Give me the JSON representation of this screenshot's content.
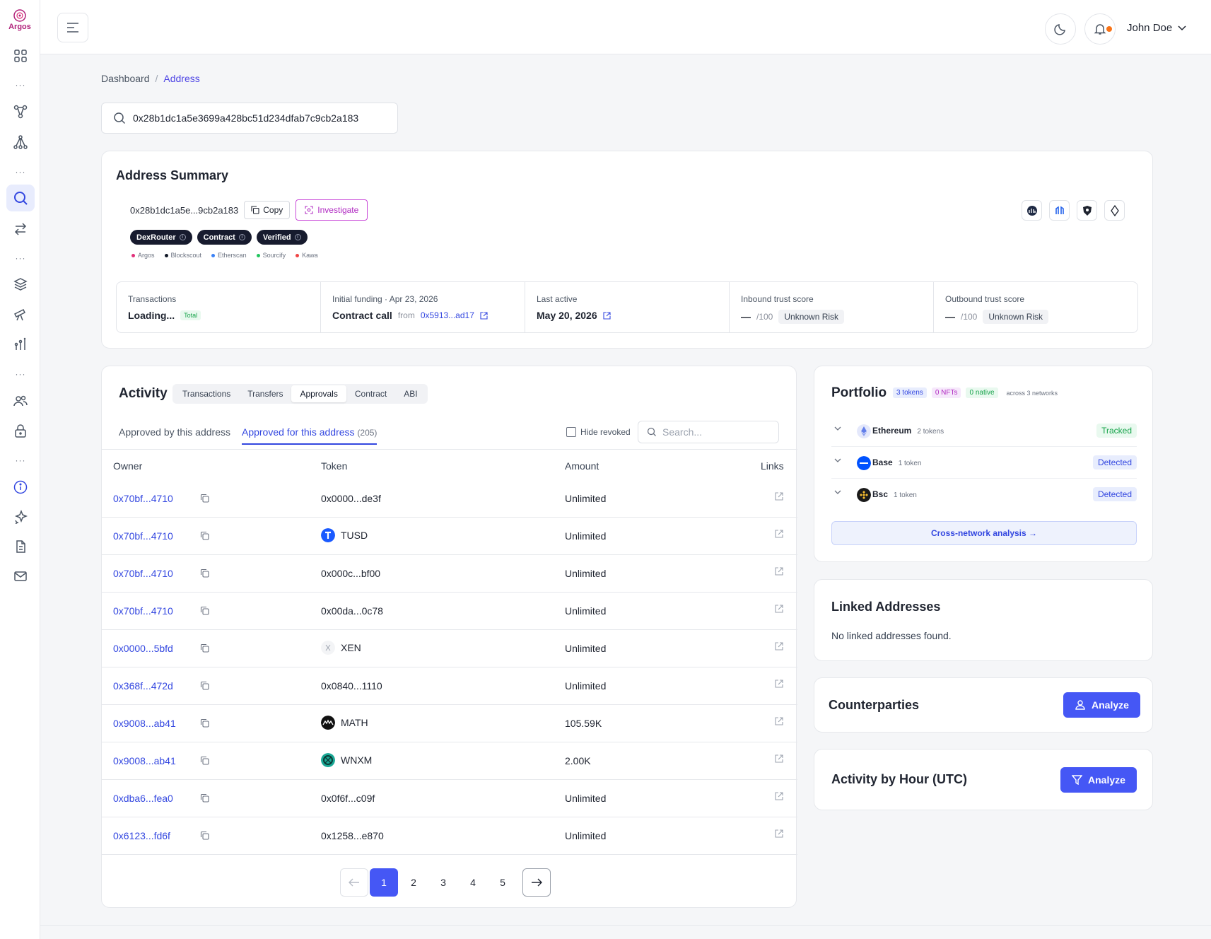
{
  "app": {
    "logo_text": "Argos"
  },
  "colors": {
    "accent": "#4557f5",
    "link": "#3347e0",
    "brand": "#b0207a"
  },
  "header": {
    "user_name": "John Doe"
  },
  "breadcrumb": {
    "root": "Dashboard",
    "separator": "/",
    "current": "Address"
  },
  "search": {
    "value": "0x28b1dc1a5e3699a428bc51d234dfab7c9cb2a183"
  },
  "summary": {
    "title": "Address Summary",
    "address_short": "0x28b1dc1a5e...9cb2a183",
    "copy_label": "Copy",
    "investigate_label": "Investigate",
    "tags": [
      "DexRouter",
      "Contract",
      "Verified"
    ],
    "sources": [
      {
        "name": "Argos",
        "color": "#e0307a"
      },
      {
        "name": "Blockscout",
        "color": "#111827"
      },
      {
        "name": "Etherscan",
        "color": "#3b82f6"
      },
      {
        "name": "Sourcify",
        "color": "#22c55e"
      },
      {
        "name": "Kawa",
        "color": "#ef4444"
      }
    ],
    "ext_icons": [
      "blockscout-icon",
      "kawa-icon",
      "sourcify-icon",
      "ethereum-icon"
    ],
    "stats": {
      "transactions": {
        "label": "Transactions",
        "value": "Loading...",
        "badge": "Total"
      },
      "funding": {
        "label": "Initial funding · Apr 23, 2026",
        "value": "Contract call",
        "from_label": "from",
        "from_addr": "0x5913...ad17"
      },
      "last_active": {
        "label": "Last active",
        "value": "May 20, 2026"
      },
      "inbound": {
        "label": "Inbound trust score",
        "value": "—",
        "max": "/100",
        "risk": "Unknown Risk"
      },
      "outbound": {
        "label": "Outbound trust score",
        "value": "—",
        "max": "/100",
        "risk": "Unknown Risk"
      }
    }
  },
  "activity": {
    "title": "Activity",
    "tabs": [
      "Transactions",
      "Transfers",
      "Approvals",
      "Contract",
      "ABI"
    ],
    "active_tab": "Approvals",
    "subtab_by": "Approved by this address",
    "subtab_for": "Approved for this address",
    "subtab_for_count": "(205)",
    "hide_revoked": "Hide revoked",
    "search_placeholder": "Search...",
    "columns": {
      "owner": "Owner",
      "token": "Token",
      "amount": "Amount",
      "links": "Links"
    },
    "rows": [
      {
        "owner": "0x70bf...4710",
        "token": "0x0000...de3f",
        "amount": "Unlimited",
        "icon": ""
      },
      {
        "owner": "0x70bf...4710",
        "token": "TUSD",
        "amount": "Unlimited",
        "icon": "tusd-icon"
      },
      {
        "owner": "0x70bf...4710",
        "token": "0x000c...bf00",
        "amount": "Unlimited",
        "icon": ""
      },
      {
        "owner": "0x70bf...4710",
        "token": "0x00da...0c78",
        "amount": "Unlimited",
        "icon": ""
      },
      {
        "owner": "0x0000...5bfd",
        "token": "XEN",
        "amount": "Unlimited",
        "icon": "xen-icon"
      },
      {
        "owner": "0x368f...472d",
        "token": "0x0840...1110",
        "amount": "Unlimited",
        "icon": ""
      },
      {
        "owner": "0x9008...ab41",
        "token": "MATH",
        "amount": "105.59K",
        "icon": "math-icon"
      },
      {
        "owner": "0x9008...ab41",
        "token": "WNXM",
        "amount": "2.00K",
        "icon": "wnxm-icon"
      },
      {
        "owner": "0xdba6...fea0",
        "token": "0x0f6f...c09f",
        "amount": "Unlimited",
        "icon": ""
      },
      {
        "owner": "0x6123...fd6f",
        "token": "0x1258...e870",
        "amount": "Unlimited",
        "icon": ""
      }
    ],
    "pages": [
      "1",
      "2",
      "3",
      "4",
      "5"
    ],
    "current_page": "1"
  },
  "portfolio": {
    "title": "Portfolio",
    "tokens_badge": "3 tokens",
    "nfts_badge": "0 NFTs",
    "native_badge": "0 native",
    "networks_text": "across 3 networks",
    "networks": [
      {
        "name": "Ethereum",
        "count": "2 tokens",
        "status": "Tracked"
      },
      {
        "name": "Base",
        "count": "1 token",
        "status": "Detected"
      },
      {
        "name": "Bsc",
        "count": "1 token",
        "status": "Detected"
      }
    ],
    "cross_network": "Cross-network analysis →"
  },
  "linked": {
    "title": "Linked Addresses",
    "empty": "No linked addresses found."
  },
  "counterparties": {
    "title": "Counterparties",
    "button": "Analyze"
  },
  "hourly": {
    "title": "Activity by Hour (UTC)",
    "button": "Analyze"
  }
}
